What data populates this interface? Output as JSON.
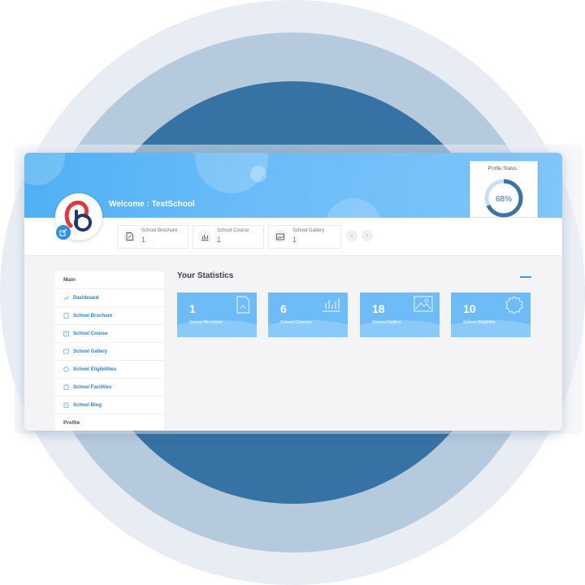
{
  "header": {
    "welcome": "Welcome : TestSchool",
    "profile_status_label": "Profile Status :",
    "profile_status_value": "68%",
    "profile_status_fraction": 0.68
  },
  "colors": {
    "accent": "#3a8be0",
    "banner": "#6cbcf8",
    "card": "#6ebcf7",
    "donut": "#3b73a6"
  },
  "mini_cards": [
    {
      "title": "School Brochure",
      "value": "1",
      "icon": "pdf-icon"
    },
    {
      "title": "School Course",
      "value": "1",
      "icon": "bar-chart-icon"
    },
    {
      "title": "School Gallery",
      "value": "1",
      "icon": "image-icon"
    }
  ],
  "nav": {
    "prev": "‹",
    "next": "›"
  },
  "sidebar": {
    "section_main": "Main",
    "items": [
      {
        "label": "Dashboard",
        "icon": "dashboard-icon"
      },
      {
        "label": "School Brochure",
        "icon": "document-icon"
      },
      {
        "label": "School Course",
        "icon": "course-icon"
      },
      {
        "label": "School Gallery",
        "icon": "gallery-icon"
      },
      {
        "label": "School Eligibilities",
        "icon": "badge-icon"
      },
      {
        "label": "School Facilities",
        "icon": "clipboard-icon"
      },
      {
        "label": "School Blog",
        "icon": "blog-icon"
      }
    ],
    "section_profile": "Profile"
  },
  "stats": {
    "title": "Your Statistics",
    "cards": [
      {
        "value": "1",
        "label": "School Brochure",
        "icon": "pdf-icon"
      },
      {
        "value": "6",
        "label": "School Courses",
        "icon": "bar-chart-icon"
      },
      {
        "value": "18",
        "label": "School Gallery",
        "icon": "image-icon"
      },
      {
        "value": "10",
        "label": "School Eligibility",
        "icon": "badge-icon"
      }
    ]
  }
}
